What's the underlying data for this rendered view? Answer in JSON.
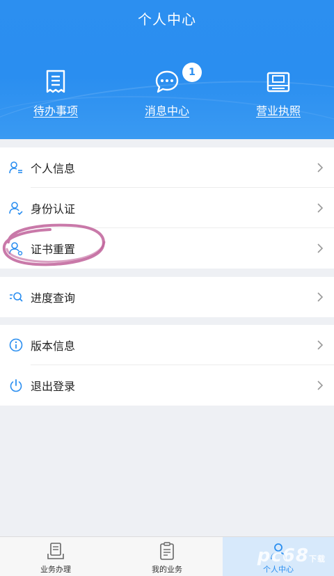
{
  "header": {
    "title": "个人中心",
    "shortcuts": [
      {
        "label": "待办事项",
        "icon": "todo-list-icon"
      },
      {
        "label": "消息中心",
        "icon": "message-bubble-icon",
        "badge": "1"
      },
      {
        "label": "营业执照",
        "icon": "business-license-icon"
      }
    ]
  },
  "menu": {
    "group1": [
      {
        "label": "个人信息",
        "icon": "user-info-icon"
      },
      {
        "label": "身份认证",
        "icon": "user-verify-icon"
      },
      {
        "label": "证书重置",
        "icon": "user-cert-icon"
      }
    ],
    "group2": [
      {
        "label": "进度查询",
        "icon": "progress-search-icon"
      }
    ],
    "group3": [
      {
        "label": "版本信息",
        "icon": "info-icon"
      },
      {
        "label": "退出登录",
        "icon": "power-icon"
      }
    ]
  },
  "tabbar": [
    {
      "label": "业务办理",
      "icon": "business-handle-icon",
      "active": false
    },
    {
      "label": "我的业务",
      "icon": "clipboard-icon",
      "active": false
    },
    {
      "label": "个人中心",
      "icon": "person-icon",
      "active": true
    }
  ],
  "watermark": {
    "text": "pc6",
    "suffix": "8",
    "sub": "下载"
  },
  "colors": {
    "primary": "#2a8ef0",
    "annotation": "#c0619a"
  }
}
